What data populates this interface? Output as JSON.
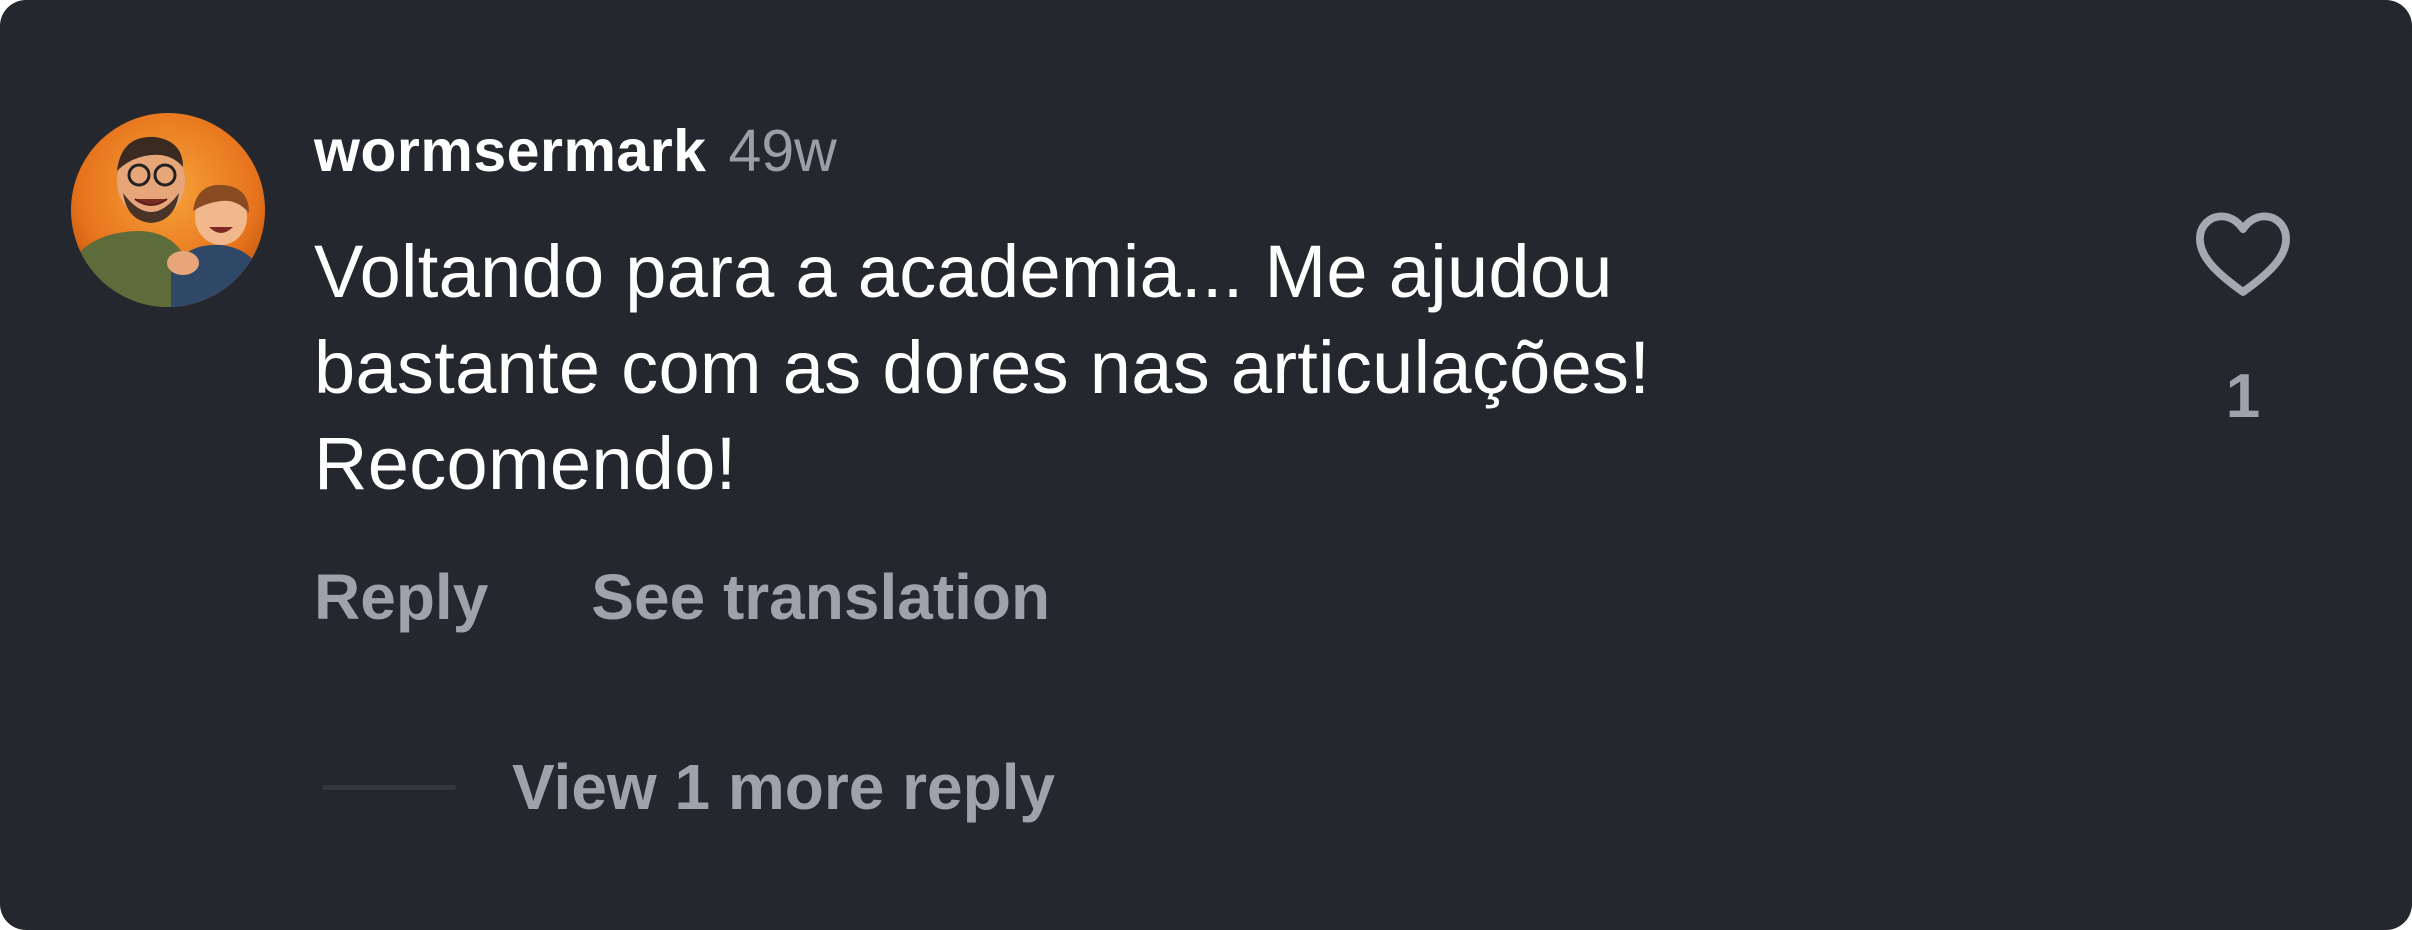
{
  "comment": {
    "username": "wormsermark",
    "timestamp": "49w",
    "text": "Voltando para a academia... Me ajudou\nbastante com as dores nas articulações!\nRecomendo!",
    "like_count": "1",
    "like_icon": "heart-outline-icon"
  },
  "actions": {
    "reply_label": "Reply",
    "translate_label": "See translation"
  },
  "replies": {
    "view_more_label": "View 1 more reply"
  },
  "colors": {
    "background": "#24272d",
    "primary_text": "#ffffff",
    "secondary_text": "#9da3ad",
    "timestamp_text": "#9a9ea6",
    "avatar_ring_orange": "#e8741e"
  }
}
